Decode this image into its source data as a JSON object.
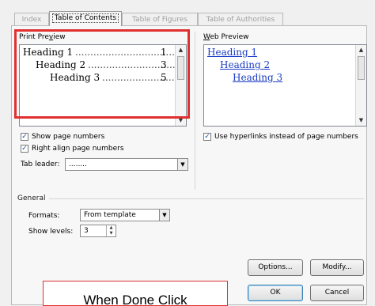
{
  "tabs": [
    {
      "label": "Index",
      "active": false
    },
    {
      "label": "Table of Contents",
      "active": true
    },
    {
      "label": "Table of Figures",
      "active": false
    },
    {
      "label": "Table of Authorities",
      "active": false
    }
  ],
  "print_preview": {
    "label": "Print Preview",
    "lines": [
      {
        "text": "Heading 1",
        "page": "1"
      },
      {
        "text": "Heading 2",
        "page": "3"
      },
      {
        "text": "Heading 3",
        "page": "5"
      }
    ]
  },
  "web_preview": {
    "label": "Web Preview",
    "links": [
      "Heading 1",
      "Heading 2",
      "Heading 3"
    ]
  },
  "options": {
    "show_page_numbers": {
      "label": "Show page numbers",
      "checked": true
    },
    "right_align": {
      "label": "Right align page numbers",
      "checked": true
    },
    "use_hyperlinks": {
      "label": "Use hyperlinks instead of page numbers",
      "checked": true
    },
    "tab_leader": {
      "label": "Tab leader:",
      "value": "........"
    }
  },
  "general": {
    "title": "General",
    "formats": {
      "label": "Formats:",
      "value": "From template"
    },
    "show_levels": {
      "label": "Show levels:",
      "value": "3"
    }
  },
  "buttons": {
    "options": "Options...",
    "modify": "Modify...",
    "ok": "OK",
    "cancel": "Cancel"
  },
  "annotation": {
    "text": "When Done Click"
  },
  "colors": {
    "highlight": "#e03030",
    "link": "#1a3cc8"
  }
}
